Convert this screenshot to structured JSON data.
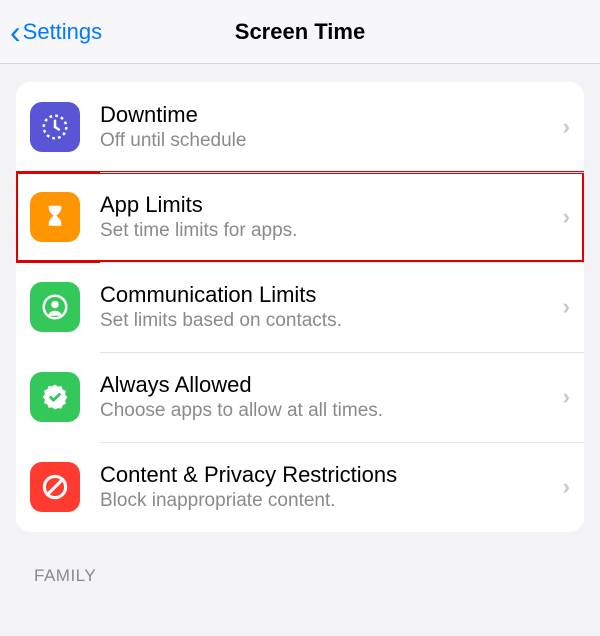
{
  "nav": {
    "back_label": "Settings",
    "title": "Screen Time"
  },
  "rows": [
    {
      "title": "Downtime",
      "subtitle": "Off until schedule",
      "icon": "downtime",
      "color": "indigo",
      "highlighted": false
    },
    {
      "title": "App Limits",
      "subtitle": "Set time limits for apps.",
      "icon": "hourglass",
      "color": "orange",
      "highlighted": true
    },
    {
      "title": "Communication Limits",
      "subtitle": "Set limits based on contacts.",
      "icon": "contact",
      "color": "green",
      "highlighted": false
    },
    {
      "title": "Always Allowed",
      "subtitle": "Choose apps to allow at all times.",
      "icon": "check-badge",
      "color": "green",
      "highlighted": false
    },
    {
      "title": "Content & Privacy Restrictions",
      "subtitle": "Block inappropriate content.",
      "icon": "no-sign",
      "color": "red",
      "highlighted": false
    }
  ],
  "footer": {
    "family_label": "FAMILY"
  }
}
